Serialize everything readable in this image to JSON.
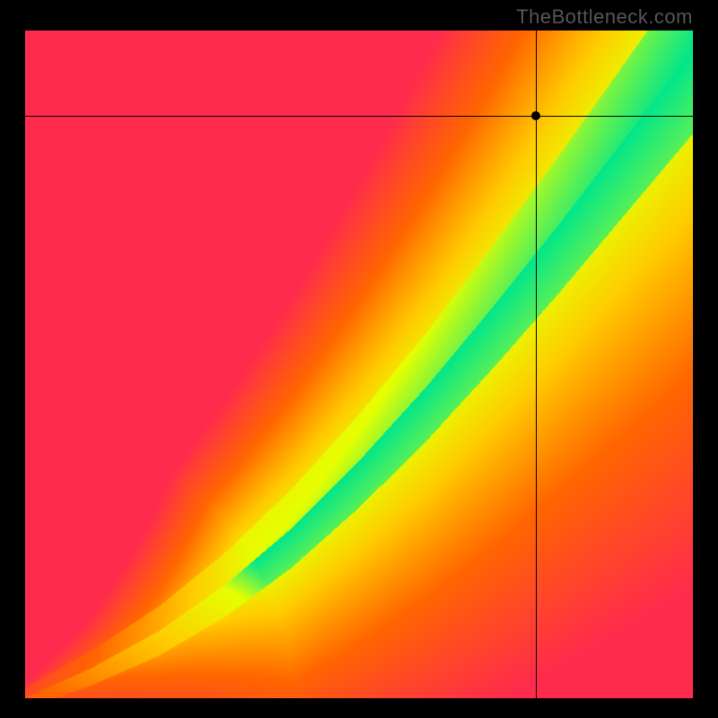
{
  "watermark": "TheBottleneck.com",
  "chart_data": {
    "type": "heatmap",
    "title": "",
    "xlabel": "",
    "ylabel": "",
    "xlim": [
      0,
      1
    ],
    "ylim": [
      0,
      1
    ],
    "crosshair": {
      "x": 0.765,
      "y": 0.872
    },
    "optimal_curve": [
      {
        "x": 0.0,
        "y": 0.0
      },
      {
        "x": 0.1,
        "y": 0.045
      },
      {
        "x": 0.2,
        "y": 0.1
      },
      {
        "x": 0.3,
        "y": 0.17
      },
      {
        "x": 0.4,
        "y": 0.255
      },
      {
        "x": 0.5,
        "y": 0.355
      },
      {
        "x": 0.6,
        "y": 0.465
      },
      {
        "x": 0.7,
        "y": 0.585
      },
      {
        "x": 0.8,
        "y": 0.71
      },
      {
        "x": 0.9,
        "y": 0.84
      },
      {
        "x": 1.0,
        "y": 0.97
      }
    ],
    "color_stops": [
      {
        "deviation": 0.0,
        "color": "#00e68c"
      },
      {
        "deviation": 0.1,
        "color": "#e6ff00"
      },
      {
        "deviation": 0.3,
        "color": "#ffcc00"
      },
      {
        "deviation": 0.6,
        "color": "#ff6600"
      },
      {
        "deviation": 1.0,
        "color": "#ff2b4d"
      }
    ],
    "note": "Heatmap encodes deviation from the optimal diagonal curve; green = balanced, red = bottlenecked."
  }
}
